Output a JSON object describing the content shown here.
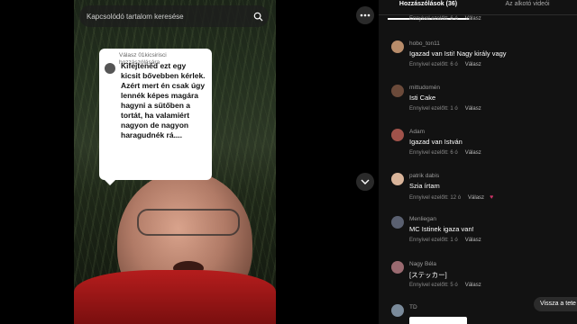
{
  "search": {
    "placeholder": "Kapcsolódó tartalom keresése"
  },
  "reply_card": {
    "meta": "Válasz 01kicsirisci hozzászólására",
    "text": "Kifejtenéd ezt egy kicsit bővebben kérlek. Azért mert én csak úgy lennék képes magára hagyni a sütőben a tortát, ha valamiért nagyon de nagyon haragudnék rá...."
  },
  "tabs": [
    {
      "label": "Hozzászólások (36)"
    },
    {
      "label": "Az alkotó videói"
    }
  ],
  "first_meta": {
    "time": "Ennyivel ezelőtt: 6 ó",
    "reply": "Válasz"
  },
  "comments": [
    {
      "user": "hobo_ton11",
      "text": "Igazad van Isti! Nagy király vagy",
      "time": "Ennyivel ezelőtt: 6 ó",
      "reply": "Válasz",
      "avatar_color": "#b88c6a"
    },
    {
      "user": "mittudomén",
      "text": "Isti Cake",
      "time": "Ennyivel ezelőtt: 1 ó",
      "reply": "Válasz",
      "avatar_color": "#6b4a3a"
    },
    {
      "user": "Adam",
      "text": "Igazad van István",
      "time": "Ennyivel ezelőtt: 6 ó",
      "reply": "Válasz",
      "avatar_color": "#a0524a"
    },
    {
      "user": "patrik dabis",
      "text": "Szia írtam",
      "time": "Ennyivel ezelőtt: 12 ó",
      "reply": "Válasz",
      "avatar_color": "#d9b49a"
    },
    {
      "user": "Menliegan",
      "text": "MC Istinek igaza van!",
      "time": "Ennyivel ezelőtt: 1 ó",
      "reply": "Válasz",
      "avatar_color": "#5a6070"
    },
    {
      "user": "Nagy Béla",
      "text": "[ステッカー]",
      "time": "Ennyivel ezelőtt: 5 ó",
      "reply": "Válasz",
      "avatar_color": "#9a6a70"
    },
    {
      "user": "TD",
      "text": "",
      "time": "",
      "reply": "",
      "avatar_color": "#7a8a9a"
    }
  ],
  "return_pill": {
    "label": "Vissza a tete"
  }
}
